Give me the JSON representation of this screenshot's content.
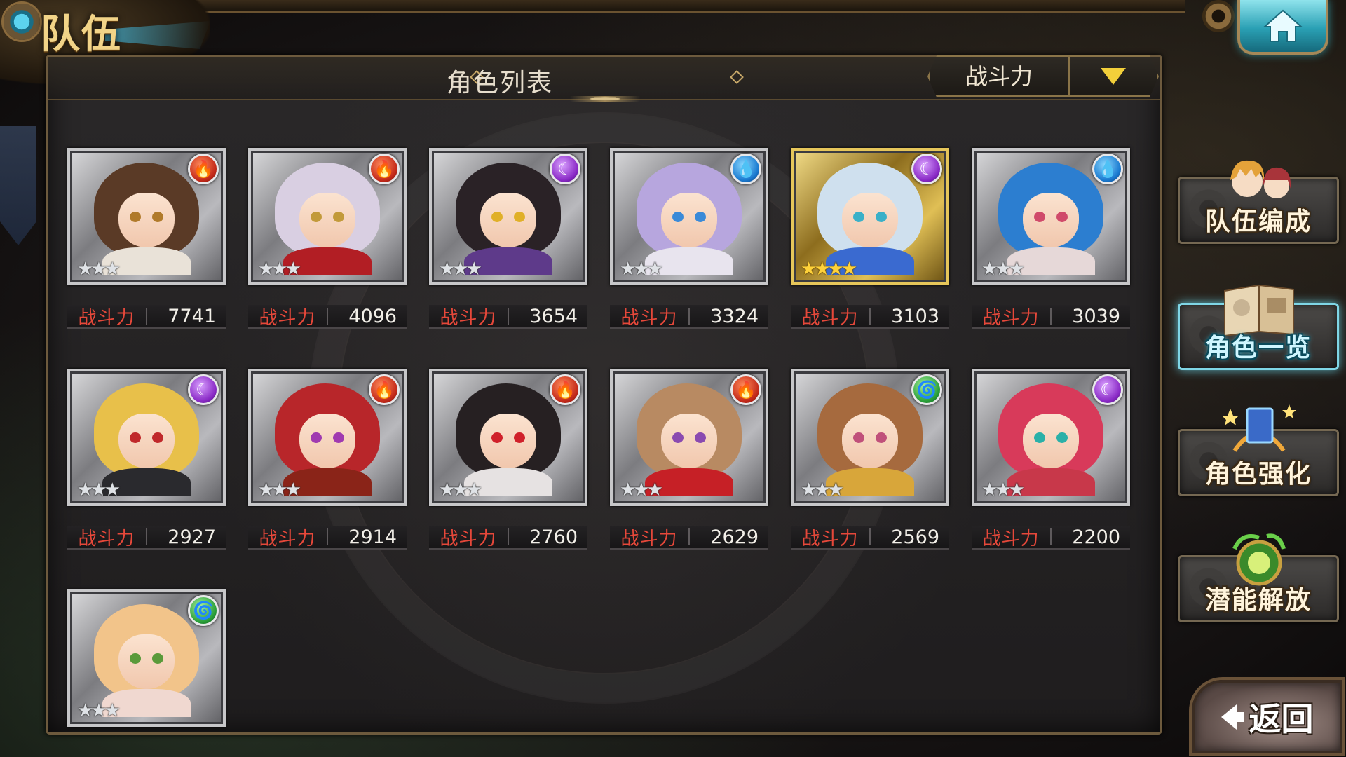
{
  "screen": {
    "title": "队伍"
  },
  "panel": {
    "title": "角色列表",
    "sort": {
      "label": "战斗力"
    }
  },
  "power_label": "战斗力",
  "characters": [
    {
      "power": "7741",
      "element": "fire",
      "rarity": 3,
      "frame": "silver",
      "hair": "#5a3a26",
      "eyes": "#b07a2a",
      "outfit": "#e9e2d8"
    },
    {
      "power": "4096",
      "element": "fire",
      "rarity": 3,
      "frame": "silver",
      "hair": "#d9cfe2",
      "eyes": "#c29a3a",
      "outfit": "#b21e24"
    },
    {
      "power": "3654",
      "element": "dark",
      "rarity": 3,
      "frame": "silver",
      "hair": "#2a2226",
      "eyes": "#e0b028",
      "outfit": "#5e3a8a"
    },
    {
      "power": "3324",
      "element": "water",
      "rarity": 3,
      "frame": "silver",
      "hair": "#b7a6de",
      "eyes": "#3a8ad8",
      "outfit": "#e8e4ee"
    },
    {
      "power": "3103",
      "element": "dark",
      "rarity": 4,
      "frame": "gold",
      "hair": "#cfe0ee",
      "eyes": "#3ab0c8",
      "outfit": "#3a6ad0"
    },
    {
      "power": "3039",
      "element": "water",
      "rarity": 3,
      "frame": "silver",
      "hair": "#2c7ed0",
      "eyes": "#d04a6a",
      "outfit": "#e6d8d8"
    },
    {
      "power": "2927",
      "element": "dark",
      "rarity": 3,
      "frame": "silver",
      "hair": "#e8c04a",
      "eyes": "#c0282a",
      "outfit": "#2a2a2e"
    },
    {
      "power": "2914",
      "element": "fire",
      "rarity": 3,
      "frame": "silver",
      "hair": "#b8262a",
      "eyes": "#a03ab0",
      "outfit": "#8a2418"
    },
    {
      "power": "2760",
      "element": "fire",
      "rarity": 3,
      "frame": "silver",
      "hair": "#262022",
      "eyes": "#d0202a",
      "outfit": "#e6e2e2"
    },
    {
      "power": "2629",
      "element": "fire",
      "rarity": 3,
      "frame": "silver",
      "hair": "#b88a62",
      "eyes": "#8a4ab0",
      "outfit": "#c62026"
    },
    {
      "power": "2569",
      "element": "wind",
      "rarity": 3,
      "frame": "silver",
      "hair": "#a66a3e",
      "eyes": "#c0507a",
      "outfit": "#d8a63a"
    },
    {
      "power": "2200",
      "element": "dark",
      "rarity": 3,
      "frame": "silver",
      "hair": "#d83a5a",
      "eyes": "#2ab0a8",
      "outfit": "#c8384a"
    },
    {
      "power": "",
      "element": "wind",
      "rarity": 3,
      "frame": "silver",
      "hair": "#f2c48a",
      "eyes": "#5a9a3a",
      "outfit": "#f0d8d0"
    }
  ],
  "menu": {
    "items": [
      {
        "label": "队伍编成",
        "active": false
      },
      {
        "label": "角色一览",
        "active": true
      },
      {
        "label": "角色强化",
        "active": false
      },
      {
        "label": "潜能解放",
        "active": false
      }
    ]
  },
  "back_button": {
    "label": "返回"
  },
  "element_icons": {
    "fire": "fire-element-icon",
    "dark": "dark-element-icon",
    "water": "water-element-icon",
    "wind": "wind-element-icon"
  },
  "colors": {
    "power_label": "#e6483a",
    "active_menu_glow": "#7fd6e6",
    "sort_arrow": "#f2cf3a"
  }
}
